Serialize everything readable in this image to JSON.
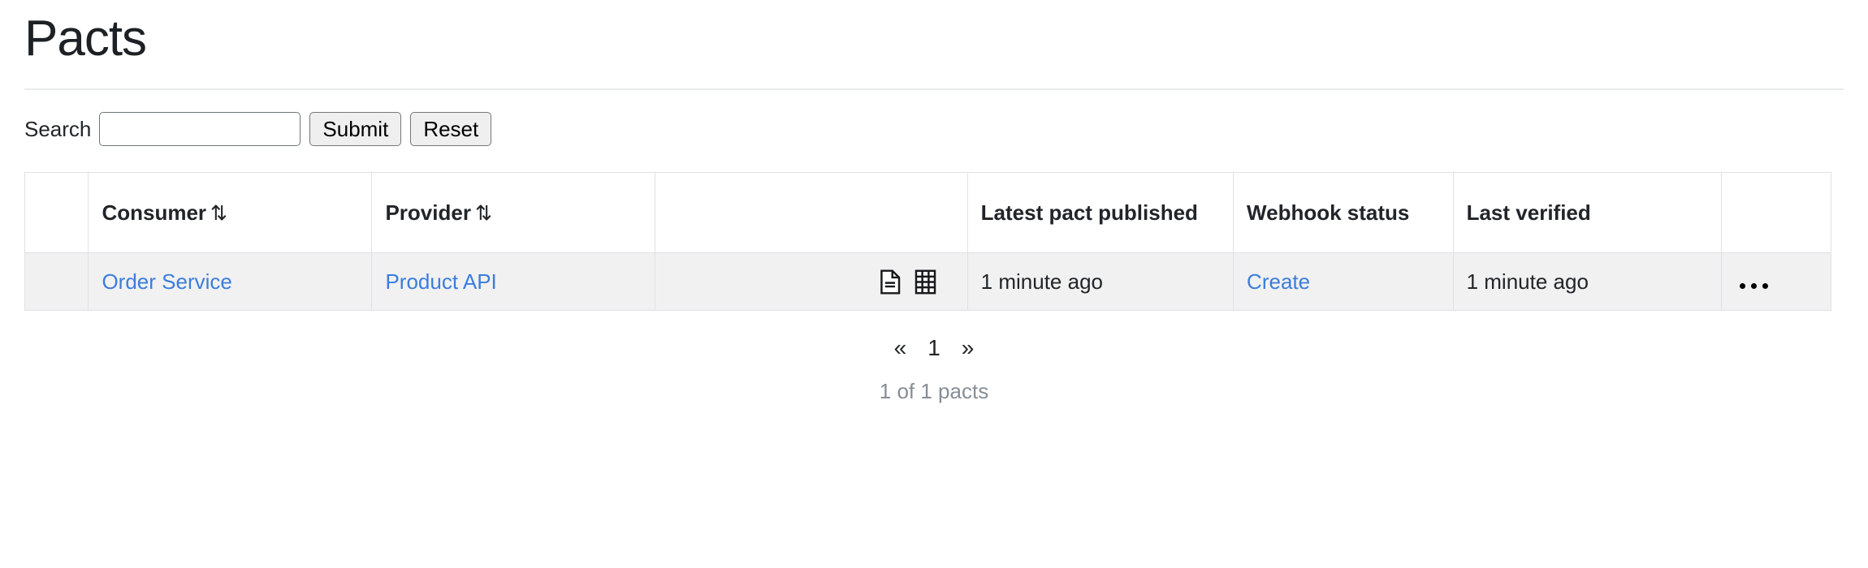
{
  "header": {
    "title": "Pacts"
  },
  "search": {
    "label": "Search",
    "value": "",
    "placeholder": "",
    "submit_label": "Submit",
    "reset_label": "Reset"
  },
  "table": {
    "columns": [
      {
        "key": "spacer",
        "label": "",
        "sortable": false
      },
      {
        "key": "consumer",
        "label": "Consumer",
        "sortable": true,
        "sort_icon": "⇅"
      },
      {
        "key": "provider",
        "label": "Provider",
        "sortable": true,
        "sort_icon": "⇅"
      },
      {
        "key": "icons",
        "label": "",
        "sortable": false
      },
      {
        "key": "latest",
        "label": "Latest pact published",
        "sortable": false
      },
      {
        "key": "webhook",
        "label": "Webhook status",
        "sortable": false
      },
      {
        "key": "verified",
        "label": "Last verified",
        "sortable": false
      },
      {
        "key": "actions",
        "label": "",
        "sortable": false
      }
    ],
    "rows": [
      {
        "consumer": "Order Service",
        "provider": "Product API",
        "icons": [
          "document-icon",
          "grid-icon"
        ],
        "latest_pact_published": "1 minute ago",
        "webhook_status": "Create",
        "last_verified": "1 minute ago",
        "last_verified_highlight": "#cbe8cf",
        "actions_icon": "ellipsis-icon"
      }
    ]
  },
  "pagination": {
    "first_label": "«",
    "current_page": "1",
    "last_label": "»"
  },
  "footer": {
    "count_text": "1 of 1 pacts"
  },
  "colors": {
    "link": "#3b7ddd",
    "success_bg": "#cbe8cf",
    "row_bg": "#f1f1f1",
    "border": "#dee2e6",
    "muted_text": "#868e96"
  }
}
